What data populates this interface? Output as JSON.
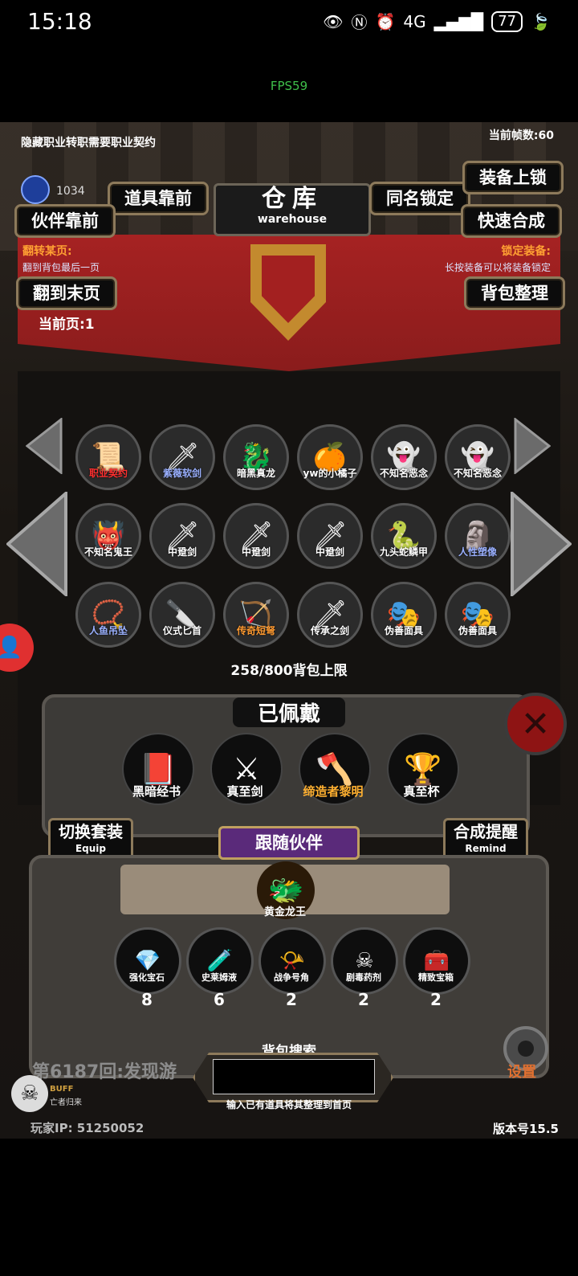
{
  "status_bar": {
    "time": "15:18",
    "network": "4G",
    "battery": "77"
  },
  "fps_overlay": "FPS59",
  "header": {
    "hint": "隐藏职业转职需要职业契约",
    "frame_count": "当前帧数:60",
    "gem_count": "1034",
    "title_cn": "仓库",
    "title_en": "warehouse"
  },
  "buttons": {
    "items_front": "道具靠前",
    "partner_front": "伙伴靠前",
    "name_lock": "同名锁定",
    "equip_lock": "装备上锁",
    "quick_merge": "快速合成",
    "to_last_page": "翻到末页",
    "bag_sort": "背包整理"
  },
  "banner": {
    "flip_label": "翻转某页:",
    "flip_desc": "翻到背包最后一页",
    "lock_label": "锁定装备:",
    "lock_desc": "长按装备可以将装备锁定",
    "current_page": "当前页:1"
  },
  "bag_items": [
    {
      "name": "职业契约",
      "icon": "scroll-icon",
      "glyph": "📜",
      "color": "#ff3030"
    },
    {
      "name": "紫薇软剑",
      "icon": "staff-icon",
      "glyph": "🗡",
      "color": "#9ab0ff"
    },
    {
      "name": "暗黑真龙",
      "icon": "ice-dragon-icon",
      "glyph": "🐉",
      "color": "#ffffff"
    },
    {
      "name": "yw的小橘子",
      "icon": "orange-icon",
      "glyph": "🍊",
      "color": "#ffffff"
    },
    {
      "name": "不知名恶念",
      "icon": "ghost-icon",
      "glyph": "👻",
      "color": "#ffffff"
    },
    {
      "name": "不知名恶念",
      "icon": "ghost-icon",
      "glyph": "👻",
      "color": "#ffffff"
    },
    {
      "name": "不知名鬼王",
      "icon": "beast-icon",
      "glyph": "👹",
      "color": "#ffffff"
    },
    {
      "name": "中跫剑",
      "icon": "sword-icon",
      "glyph": "🗡",
      "color": "#ffffff"
    },
    {
      "name": "中跫剑",
      "icon": "sword-icon",
      "glyph": "🗡",
      "color": "#ffffff"
    },
    {
      "name": "中跫剑",
      "icon": "sword-icon",
      "glyph": "🗡",
      "color": "#ffffff"
    },
    {
      "name": "九头蛇鳞甲",
      "icon": "hydra-armor-icon",
      "glyph": "🐍",
      "color": "#ffffff"
    },
    {
      "name": "人性塑像",
      "icon": "statue-icon",
      "glyph": "🗿",
      "color": "#9ab0ff"
    },
    {
      "name": "人鱼吊坠",
      "icon": "pendant-icon",
      "glyph": "📿",
      "color": "#9ab0ff"
    },
    {
      "name": "仪式匕首",
      "icon": "dagger-icon",
      "glyph": "🔪",
      "color": "#ffffff"
    },
    {
      "name": "传奇短弩",
      "icon": "crossbow-icon",
      "glyph": "🏹",
      "color": "#ff9a30"
    },
    {
      "name": "传承之剑",
      "icon": "sword-icon",
      "glyph": "🗡",
      "color": "#ffffff"
    },
    {
      "name": "伪善面具",
      "icon": "mask-icon",
      "glyph": "🎭",
      "color": "#ffffff"
    },
    {
      "name": "伪善面具",
      "icon": "mask-icon",
      "glyph": "🎭",
      "color": "#ffffff"
    }
  ],
  "capacity": "258/800背包上限",
  "equipped": {
    "title": "已佩戴",
    "items": [
      {
        "name": "黑暗经书",
        "icon": "book-icon",
        "glyph": "📕",
        "color": "#ffffff"
      },
      {
        "name": "真至剑",
        "icon": "sword-icon",
        "glyph": "⚔",
        "color": "#ffffff"
      },
      {
        "name": "缔造者黎明",
        "icon": "axe-icon",
        "glyph": "🪓",
        "color": "#ffb030"
      },
      {
        "name": "真至杯",
        "icon": "cup-icon",
        "glyph": "🏆",
        "color": "#ffffff"
      }
    ]
  },
  "side_buttons": {
    "switch_set": "切换套装",
    "switch_set_en": "Equip",
    "merge_remind": "合成提醒",
    "merge_remind_en": "Remind"
  },
  "partner": {
    "title": "跟随伙伴",
    "name": "黄金龙王",
    "icon": "golden-dragon-icon"
  },
  "consumables": [
    {
      "name": "强化宝石",
      "count": "8",
      "icon": "gem-icon",
      "glyph": "💎"
    },
    {
      "name": "史莱姆液",
      "count": "6",
      "icon": "potion-icon",
      "glyph": "🧪"
    },
    {
      "name": "战争号角",
      "count": "2",
      "icon": "horn-icon",
      "glyph": "📯"
    },
    {
      "name": "剧毒药剂",
      "count": "2",
      "icon": "poison-icon",
      "glyph": "☠"
    },
    {
      "name": "精致宝箱",
      "count": "2",
      "icon": "chest-icon",
      "glyph": "🧰"
    }
  ],
  "search": {
    "title": "背包搜索",
    "value": "",
    "hint": "输入已有道具将其整理到首页"
  },
  "footer": {
    "scroll_message": "第6187回:发现游",
    "buff_label": "BUFF",
    "buff_sub": "亡者归来",
    "player_ip": "玩家IP:  51250052",
    "version": "版本号15.5",
    "settings": "设置"
  },
  "colors": {
    "banner_red": "#a62222",
    "accent_gold": "#8d7a5b",
    "partner_purple": "#5a2a7a"
  }
}
